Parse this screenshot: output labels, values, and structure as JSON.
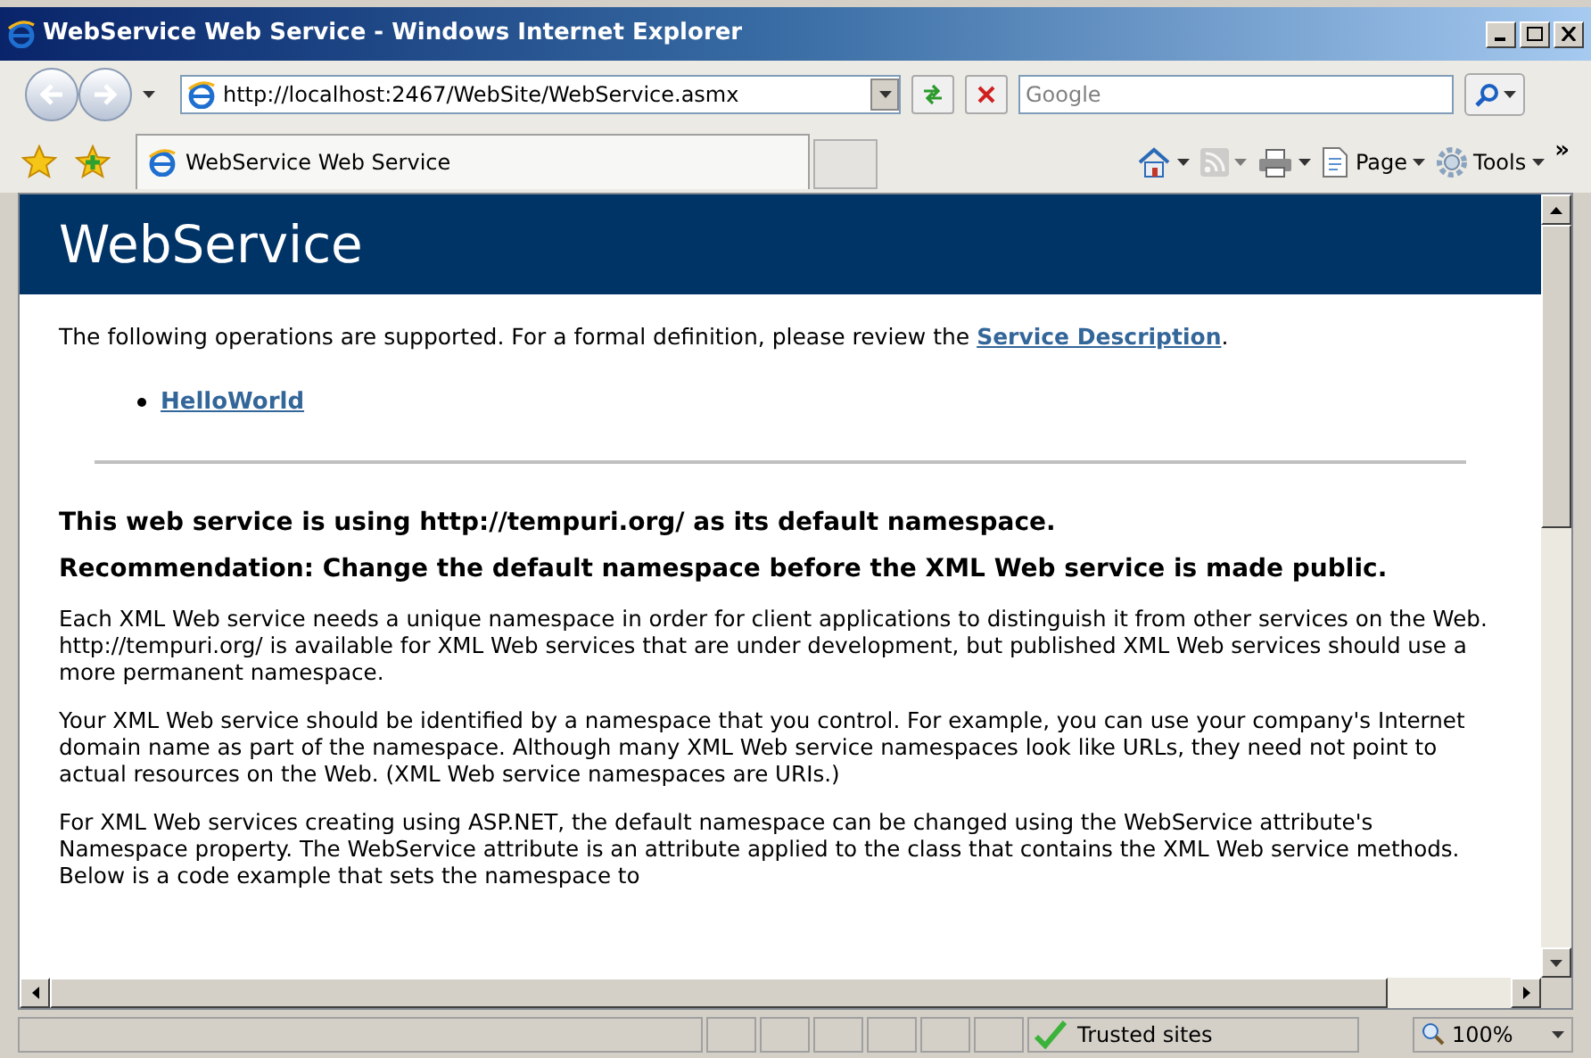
{
  "window": {
    "title": "WebService Web Service - Windows Internet Explorer"
  },
  "address_bar": {
    "url": "http://localhost:2467/WebSite/WebService.asmx"
  },
  "search": {
    "placeholder": "Google"
  },
  "tabs": [
    {
      "label": "WebService Web Service",
      "selected": true
    }
  ],
  "command_bar": [
    {
      "kind": "home"
    },
    {
      "kind": "feeds",
      "disabled": true
    },
    {
      "kind": "print"
    },
    {
      "kind": "page",
      "label": "Page"
    },
    {
      "kind": "tools",
      "label": "Tools"
    }
  ],
  "command_bar_more": "»",
  "page": {
    "heading": "WebService",
    "intro": "The following operations are supported. For a formal definition, please review the ",
    "intro_link": "Service Description",
    "intro_end": ".",
    "operations": [
      "HelloWorld"
    ],
    "namespace_note": "This web service is using http://tempuri.org/ as its default namespace.",
    "recommendation": "Recommendation: Change the default namespace before the XML Web service is made public.",
    "paragraphs": [
      "Each XML Web service needs a unique namespace in order for client applications to distinguish it from other services on the Web. http://tempuri.org/ is available for XML Web services that are under development, but published XML Web services should use a more permanent namespace.",
      "Your XML Web service should be identified by a namespace that you control. For example, you can use your company's Internet domain name as part of the namespace. Although many XML Web service namespaces look like URLs, they need not point to actual resources on the Web. (XML Web service namespaces are URIs.)",
      "For XML Web services creating using ASP.NET, the default namespace can be changed using the WebService attribute's Namespace property. The WebService attribute is an attribute applied to the class that contains the XML Web service methods. Below is a code example that sets the namespace to"
    ]
  },
  "status_bar": {
    "zone": "Trusted sites",
    "zoom": "100%"
  }
}
